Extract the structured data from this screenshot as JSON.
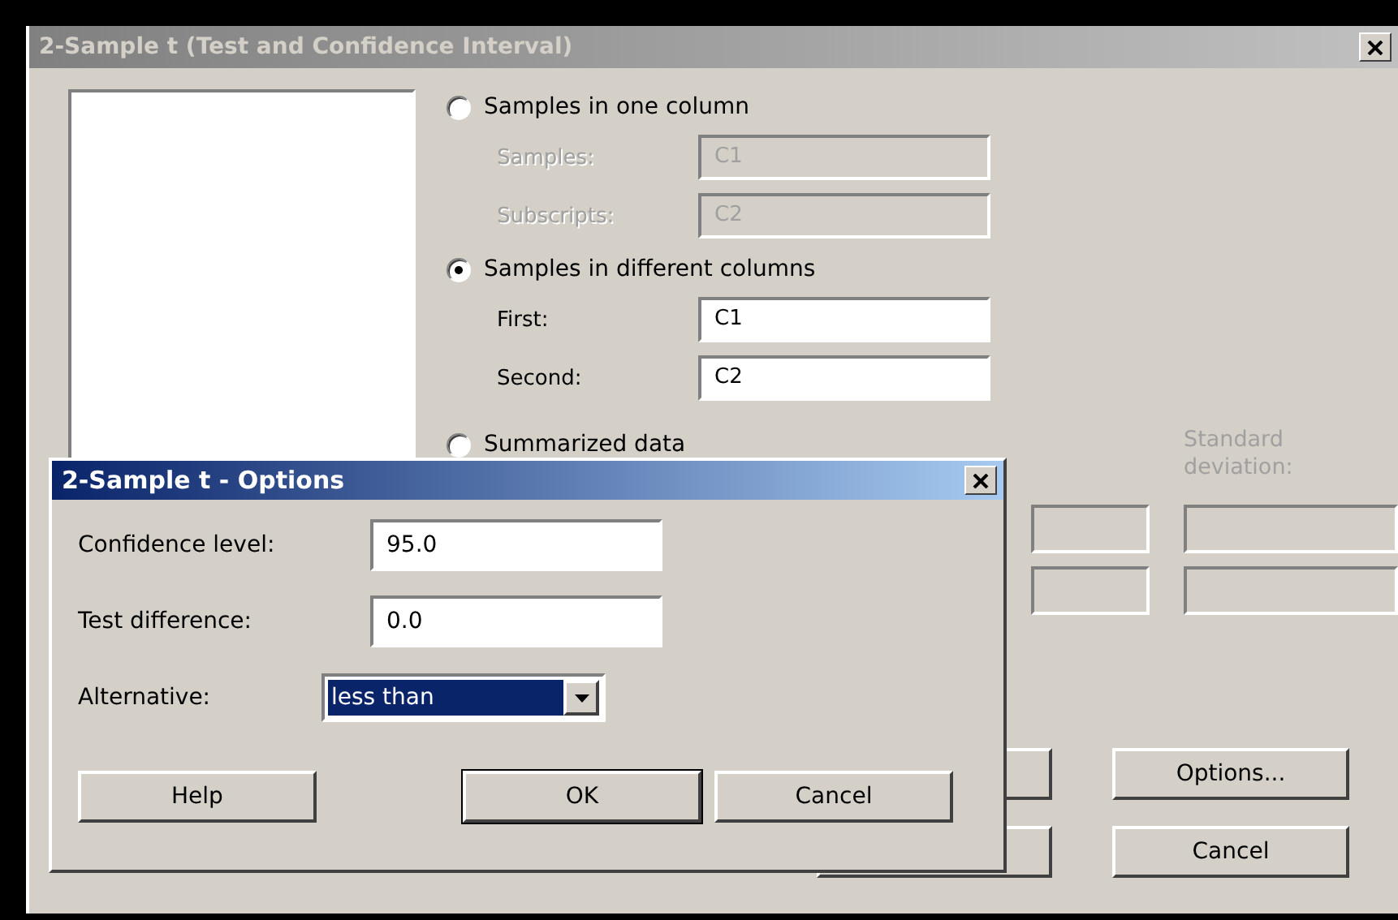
{
  "main_window": {
    "title": "2-Sample t (Test and Confidence Interval)",
    "active": false,
    "choices": [
      {
        "label": "Samples in one column",
        "selected": false,
        "fields": [
          {
            "label": "Samples:",
            "value": "C1",
            "disabled": true
          },
          {
            "label": "Subscripts:",
            "value": "C2",
            "disabled": true
          }
        ]
      },
      {
        "label": "Samples in different columns",
        "selected": true,
        "fields": [
          {
            "label": "First:",
            "value": "C1",
            "disabled": false
          },
          {
            "label": "Second:",
            "value": "C2",
            "disabled": false
          }
        ]
      },
      {
        "label": "Summarized data",
        "selected": false
      }
    ],
    "summary_header": "Standard deviation:",
    "buttons": [
      "Options...",
      "Cancel"
    ]
  },
  "options_dialog": {
    "title": "2-Sample t - Options",
    "active": true,
    "fields": [
      {
        "label": "Confidence level:",
        "value": "95.0"
      },
      {
        "label": "Test difference:",
        "value": "0.0"
      }
    ],
    "alternative": {
      "label": "Alternative:",
      "value": "less than"
    },
    "buttons": [
      {
        "label": "Help",
        "default": false
      },
      {
        "label": "OK",
        "default": true
      },
      {
        "label": "Cancel",
        "default": false
      }
    ]
  }
}
